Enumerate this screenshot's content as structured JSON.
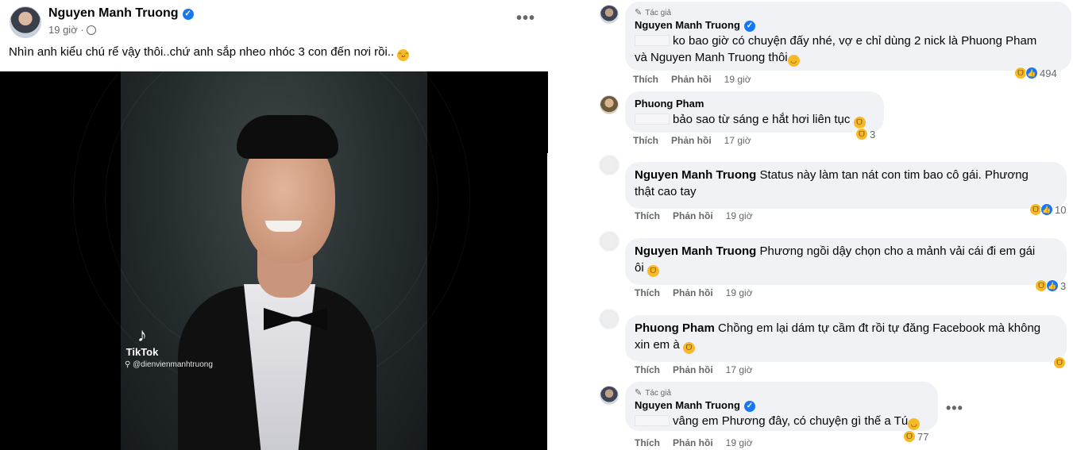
{
  "post": {
    "author": "Nguyen Manh Truong",
    "time": "19 giờ ·",
    "text": "Nhìn anh kiểu chú rể vậy thôi..chứ anh sắp nheo nhóc 3 con đến nơi rồi..",
    "more_icon": "more-horizontal-icon",
    "video": {
      "watermark": "TikTok",
      "handle": "@dienvienmanhtruong"
    }
  },
  "comments": [
    {
      "author_tag": "Tác giả",
      "name": "Nguyen Manh Truong",
      "text": "ko bao giờ có chuyện đấy nhé, vợ e chỉ dùng 2 nick là Phuong Pham",
      "text2": "và Nguyen Manh Truong thôi",
      "like": "Thích",
      "reply": "Phản hồi",
      "time": "19 giờ",
      "count": "494"
    },
    {
      "name": "Phuong Pham",
      "text": "bảo sao từ sáng e hắt hơi liên tục",
      "like": "Thích",
      "reply": "Phản hồi",
      "time": "17 giờ",
      "count": "3"
    },
    {
      "name": "Nguyen Manh Truong",
      "text": "Status này làm tan nát con tim bao cô gái. Phương",
      "text2": "thật cao tay",
      "like": "Thích",
      "reply": "Phản hồi",
      "time": "19 giờ",
      "count": "10"
    },
    {
      "name": "Nguyen Manh Truong",
      "text": "Phương ngồi dậy chọn cho a mảnh vải cái đi em gái",
      "text2": "ôi",
      "like": "Thích",
      "reply": "Phản hồi",
      "time": "19 giờ",
      "count": "3"
    },
    {
      "name": "Phuong Pham",
      "text": "Chồng em lại dám tự cầm đt rồi tự đăng Facebook mà không",
      "text2": "xin em à",
      "like": "Thích",
      "reply": "Phản hồi",
      "time": "17 giờ"
    },
    {
      "author_tag": "Tác giả",
      "name": "Nguyen Manh Truong",
      "text": "vâng em Phương đây, có chuyện gì thế a Tú",
      "like": "Thích",
      "reply": "Phản hồi",
      "time": "19 giờ",
      "count": "77"
    }
  ]
}
